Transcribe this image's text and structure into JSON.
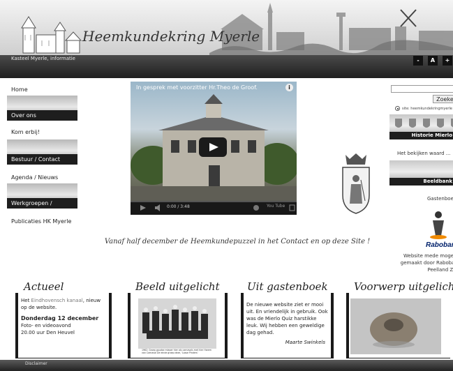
{
  "header": {
    "site_title": "Heemkundekring Myerle",
    "breadcrumb": "Kasteel Myerle, informatie",
    "font_buttons": [
      "-",
      "A",
      "+"
    ]
  },
  "nav": {
    "home": "Home",
    "over_ons": "Over ons",
    "kom_erbij": "Kom erbij!",
    "bestuur": "Bestuur / Contact",
    "agenda": "Agenda / Nieuws",
    "werkgroepen": "Werkgroepen / Projecten",
    "publicaties": "Publicaties HK Myerle"
  },
  "video": {
    "title": "In gesprek met voorzitter Hr.Theo de Groof.",
    "time": "0:00 / 3:48",
    "brand": "You Tube"
  },
  "puzzle_text": "Vanaf half december de Heemkundepuzzel in het Contact en op deze Site !",
  "right": {
    "search_button": "Zoeken",
    "site_option": "site: heemkundekringmyerle",
    "historie": "Historie Mierlo",
    "bekijken": "Het bekijken waard ...",
    "beeldbank": "Beeldbank",
    "gastenboek": "Gastenboek",
    "rabo_logo": "Rabobank",
    "rabo_text": "Website mede mogelijk gemaakt door Rabobank Peelland Zuid"
  },
  "boxes": {
    "actueel": {
      "heading": "Actueel",
      "line1_prefix": "Het ",
      "link": "Eindhovensch kanaal",
      "line1_suffix": ", nieuw op de website.",
      "date": "Donderdag 12 december",
      "event1": "Foto- en videoavond",
      "event2": "20.00 uur Den Heuvel"
    },
    "beeld": {
      "heading": "Beeld uitgelicht",
      "caption": "1962: Groep goudse mieper hier als carnavals met hier Harem van Carnaval   De einde groep deze, 'Losse Pinders'"
    },
    "gastenboek": {
      "heading": "Uit gastenboek",
      "text": "De nieuwe website ziet er mooi uit. En vriendelijk in gebruik. Ook was de Mierlo Quiz harstikke leuk. Wij hebben een geweldige dag gehad.",
      "author": "Maarte Swinkels"
    },
    "voorwerp": {
      "heading": "Voorwerp uitgelicht"
    }
  },
  "footer": {
    "disclaimer": "Disclaimer"
  },
  "colors": {
    "dark_bar": "#1e1e1e",
    "link": "#7a7a7a",
    "rabo_orange": "#f08a00",
    "rabo_blue": "#00216b"
  }
}
